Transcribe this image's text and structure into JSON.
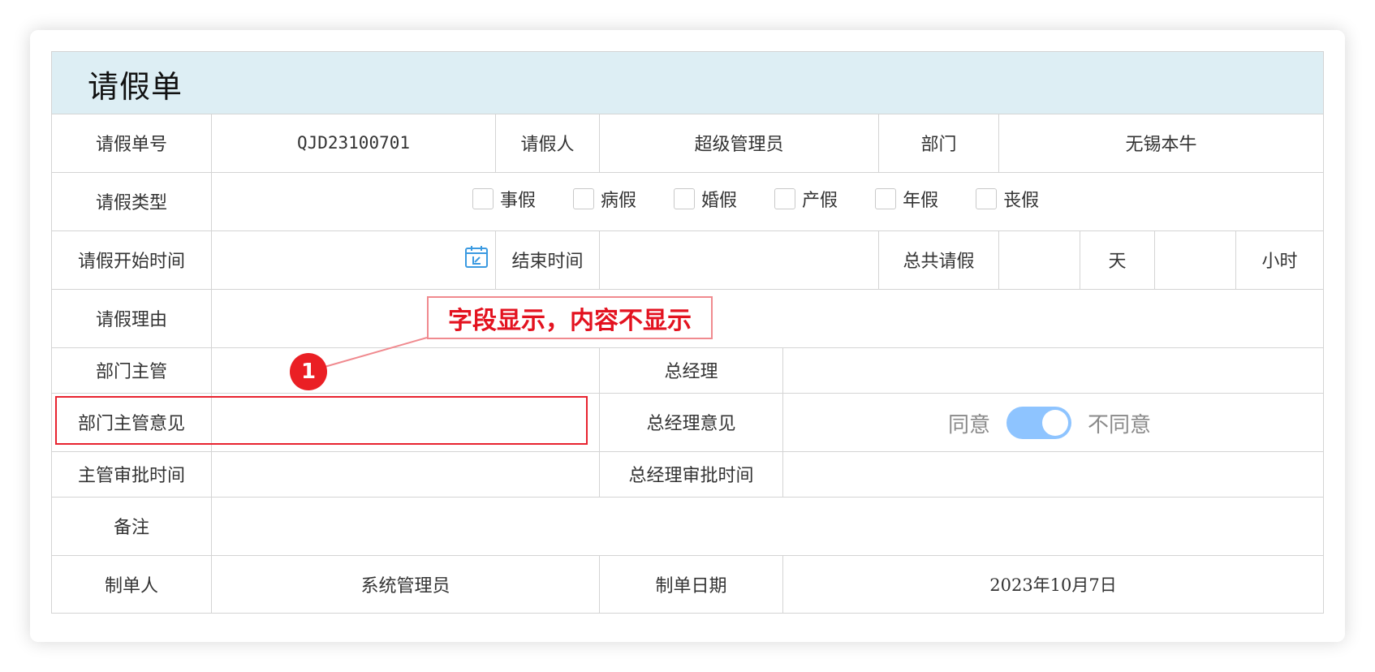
{
  "form": {
    "title": "请假单",
    "row1": {
      "no_label": "请假单号",
      "no_value": "QJD23100701",
      "applicant_label": "请假人",
      "applicant_value": "超级管理员",
      "dept_label": "部门",
      "dept_value": "无锡本牛"
    },
    "row2": {
      "type_label": "请假类型",
      "types": [
        "事假",
        "病假",
        "婚假",
        "产假",
        "年假",
        "丧假"
      ]
    },
    "row3": {
      "start_label": "请假开始时间",
      "end_label": "结束时间",
      "total_label": "总共请假",
      "days_unit": "天",
      "hours_unit": "小时"
    },
    "row4": {
      "reason_label": "请假理由"
    },
    "row5": {
      "supervisor_label": "部门主管",
      "gm_label": "总经理"
    },
    "row6": {
      "supervisor_opinion_label": "部门主管意见",
      "gm_opinion_label": "总经理意见",
      "agree_label": "同意",
      "disagree_label": "不同意",
      "toggle_on": true
    },
    "row7": {
      "supervisor_time_label": "主管审批时间",
      "gm_time_label": "总经理审批时间"
    },
    "row8": {
      "remark_label": "备注"
    },
    "row9": {
      "creator_label": "制单人",
      "creator_value": "系统管理员",
      "date_label": "制单日期",
      "date_value": "2023年10月7日"
    }
  },
  "annotation": {
    "callout_text": "字段显示，内容不显示",
    "marker_number": "1"
  },
  "colors": {
    "header_bg": "#ddeef4",
    "toggle": "#8ec4ff",
    "annotation_red": "#e3121f",
    "calendar_icon": "#3b9ae1"
  }
}
